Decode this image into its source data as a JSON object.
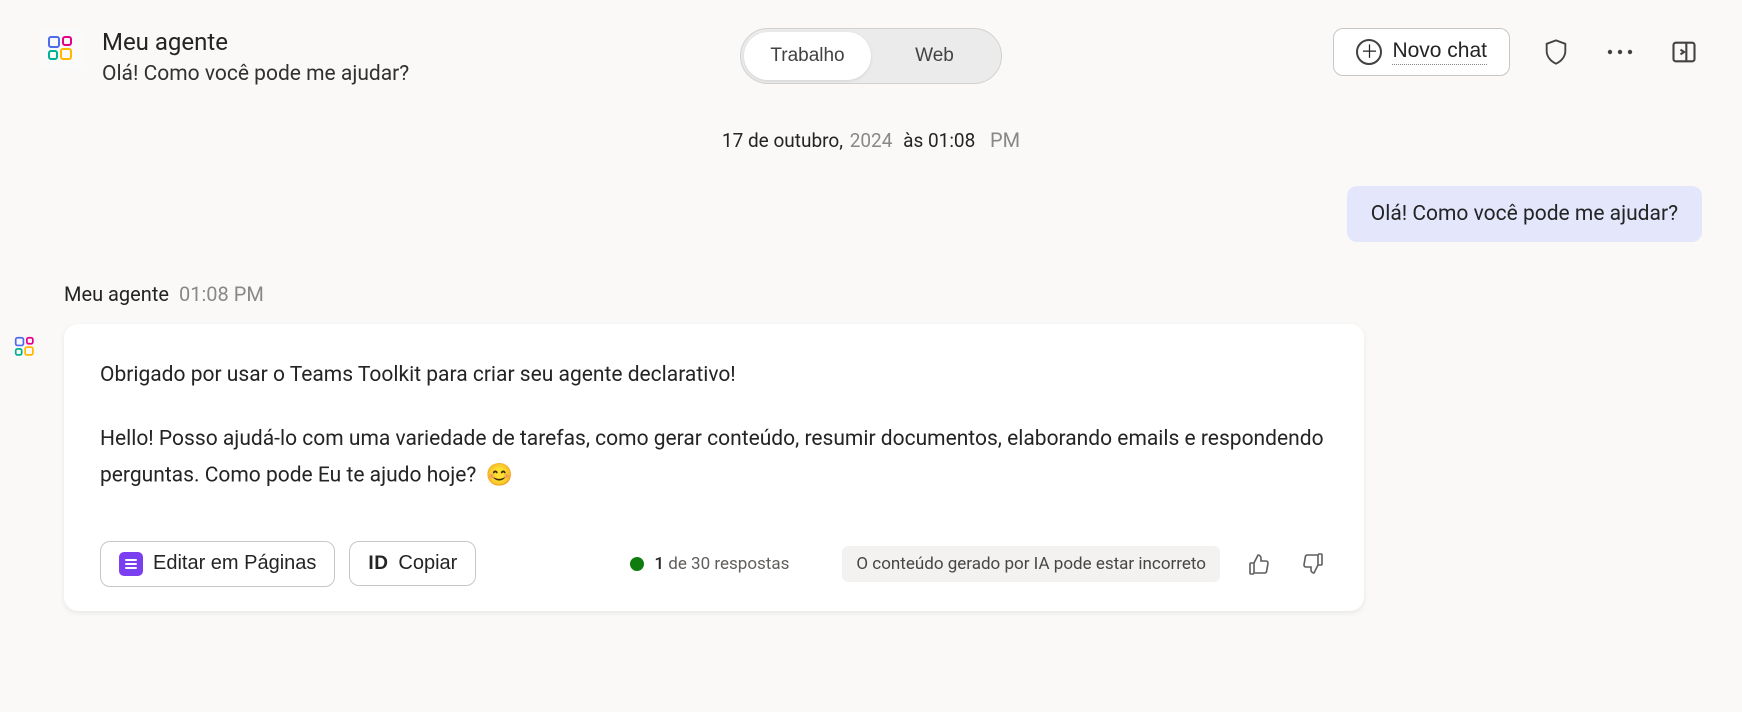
{
  "header": {
    "agent_title": "Meu agente",
    "agent_subtitle": "Olá!    Como você pode me ajudar?",
    "toggle": {
      "work": "Trabalho",
      "web": "Web"
    },
    "new_chat": "Novo chat"
  },
  "timestamp": {
    "day": "17 de outubro,",
    "year": "2024",
    "time": "às 01:08",
    "ampm": "PM"
  },
  "user_message": "Olá!    Como você pode me ajudar?",
  "agent_meta": {
    "name": "Meu agente",
    "time": "01:08 PM"
  },
  "agent_message": {
    "p1": "Obrigado por usar o Teams Toolkit para criar seu agente declarativo!",
    "p2a": "Hello!   Posso ajudá-lo com uma variedade de tarefas, como gerar conteúdo, resumir documentos, elaborando emails e respondendo perguntas. Como pode     Eu te ajudo hoje?",
    "emoji": "😊"
  },
  "footer": {
    "edit_pages": "Editar em Páginas",
    "copy_id": "ID",
    "copy_label": "Copiar",
    "responses_count": "1",
    "responses_total": "de 30 respostas",
    "ai_disclaimer": "O conteúdo gerado por IA pode estar incorreto"
  },
  "icons": {
    "shield": "shield-icon",
    "more": "more-icon",
    "panel": "panel-icon",
    "thumb_up": "thumb-up-icon",
    "thumb_down": "thumb-down-icon"
  }
}
